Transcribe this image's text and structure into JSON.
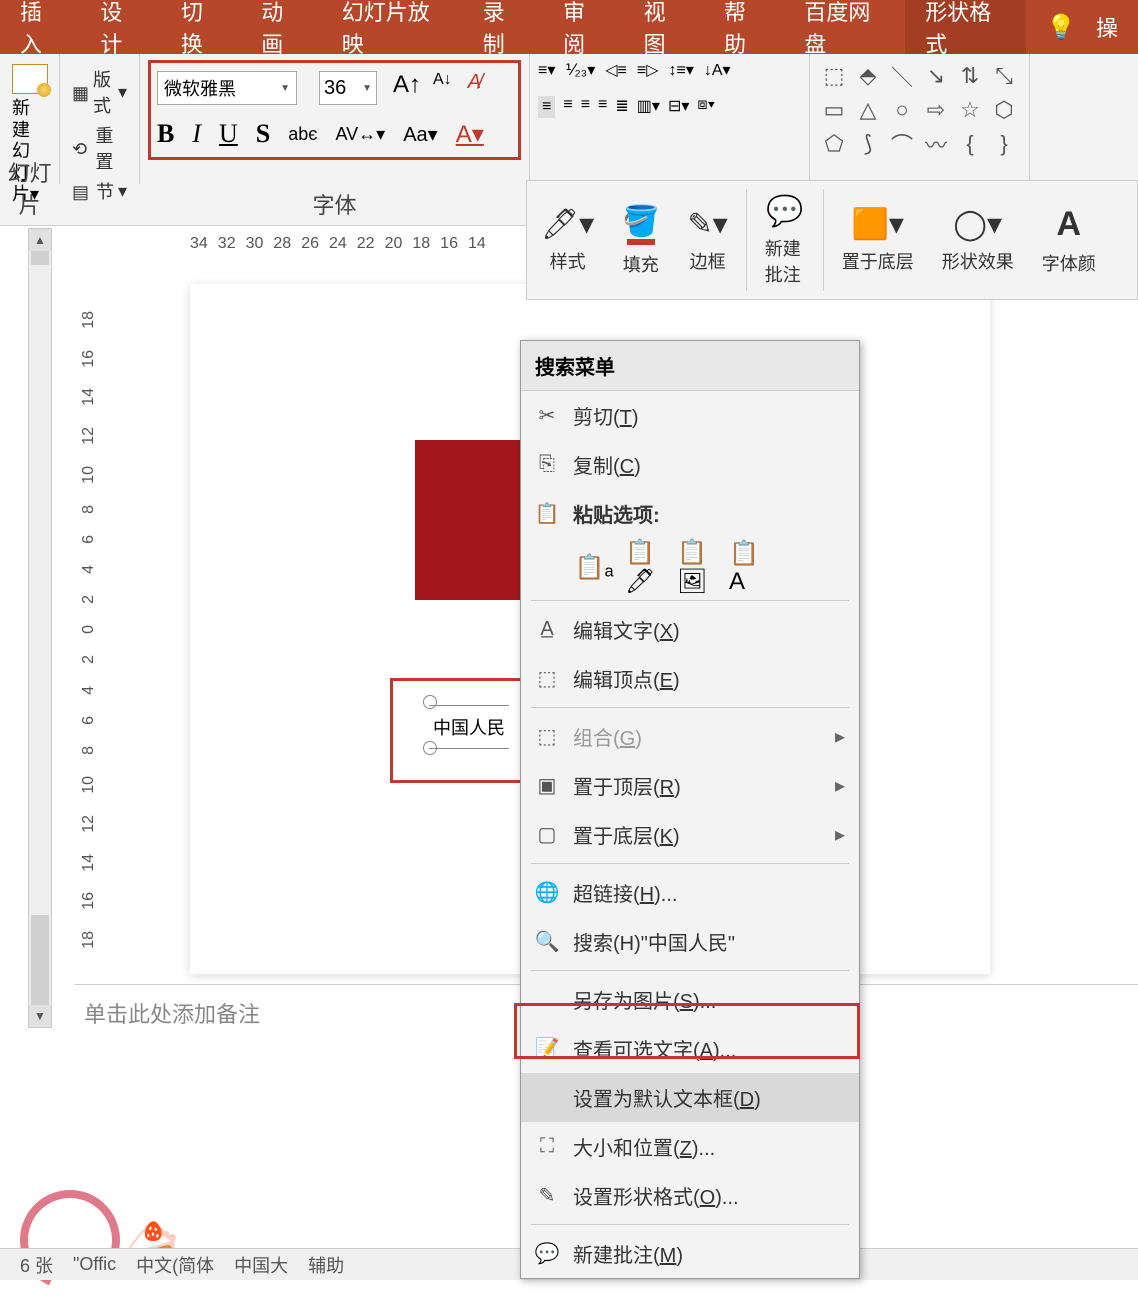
{
  "tabs": [
    "插入",
    "设计",
    "切换",
    "动画",
    "幻灯片放映",
    "录制",
    "审阅",
    "视图",
    "帮助",
    "百度网盘",
    "形状格式",
    "操"
  ],
  "active_tab": "形状格式",
  "slides_group": {
    "new_slide": "新建幻灯片",
    "layout": "版式",
    "reset": "重置",
    "section": "节",
    "label": "幻灯片"
  },
  "font_group": {
    "font_name": "微软雅黑",
    "font_size": "36",
    "label": "字体"
  },
  "secondary": {
    "style": "样式",
    "fill": "填充",
    "border": "边框",
    "new_comment": "新建批注",
    "send_back": "置于底层",
    "shape_effect": "形状效果",
    "font_color": "字体颜"
  },
  "ruler_h": [
    "34",
    "32",
    "30",
    "28",
    "26",
    "24",
    "22",
    "20",
    "18",
    "16",
    "14"
  ],
  "ruler_v": [
    "18",
    "16",
    "14",
    "12",
    "10",
    "8",
    "6",
    "4",
    "2",
    "0",
    "2",
    "4",
    "6",
    "8",
    "10",
    "12",
    "14",
    "16",
    "18"
  ],
  "slide_textbox": "中国人民",
  "context_menu": {
    "search": "搜索菜单",
    "cut": "剪切(T)",
    "copy": "复制(C)",
    "paste_label": "粘贴选项:",
    "edit_text": "编辑文字(X)",
    "edit_points": "编辑顶点(E)",
    "group": "组合(G)",
    "bring_front": "置于顶层(R)",
    "send_back": "置于底层(K)",
    "hyperlink": "超链接(H)...",
    "search_text": "搜索(H)\"中国人民\"",
    "save_as_pic": "另存为图片(S)...",
    "alt_text": "查看可选文字(A)...",
    "set_default": "设置为默认文本框(D)",
    "size_pos": "大小和位置(Z)...",
    "format_shape": "设置形状格式(O)...",
    "new_comment": "新建批注(M)"
  },
  "notes_placeholder": "单击此处添加备注",
  "status": {
    "office": "\"Offic",
    "lang": "中文(简体",
    "region": "中国大",
    "access": "辅助"
  }
}
